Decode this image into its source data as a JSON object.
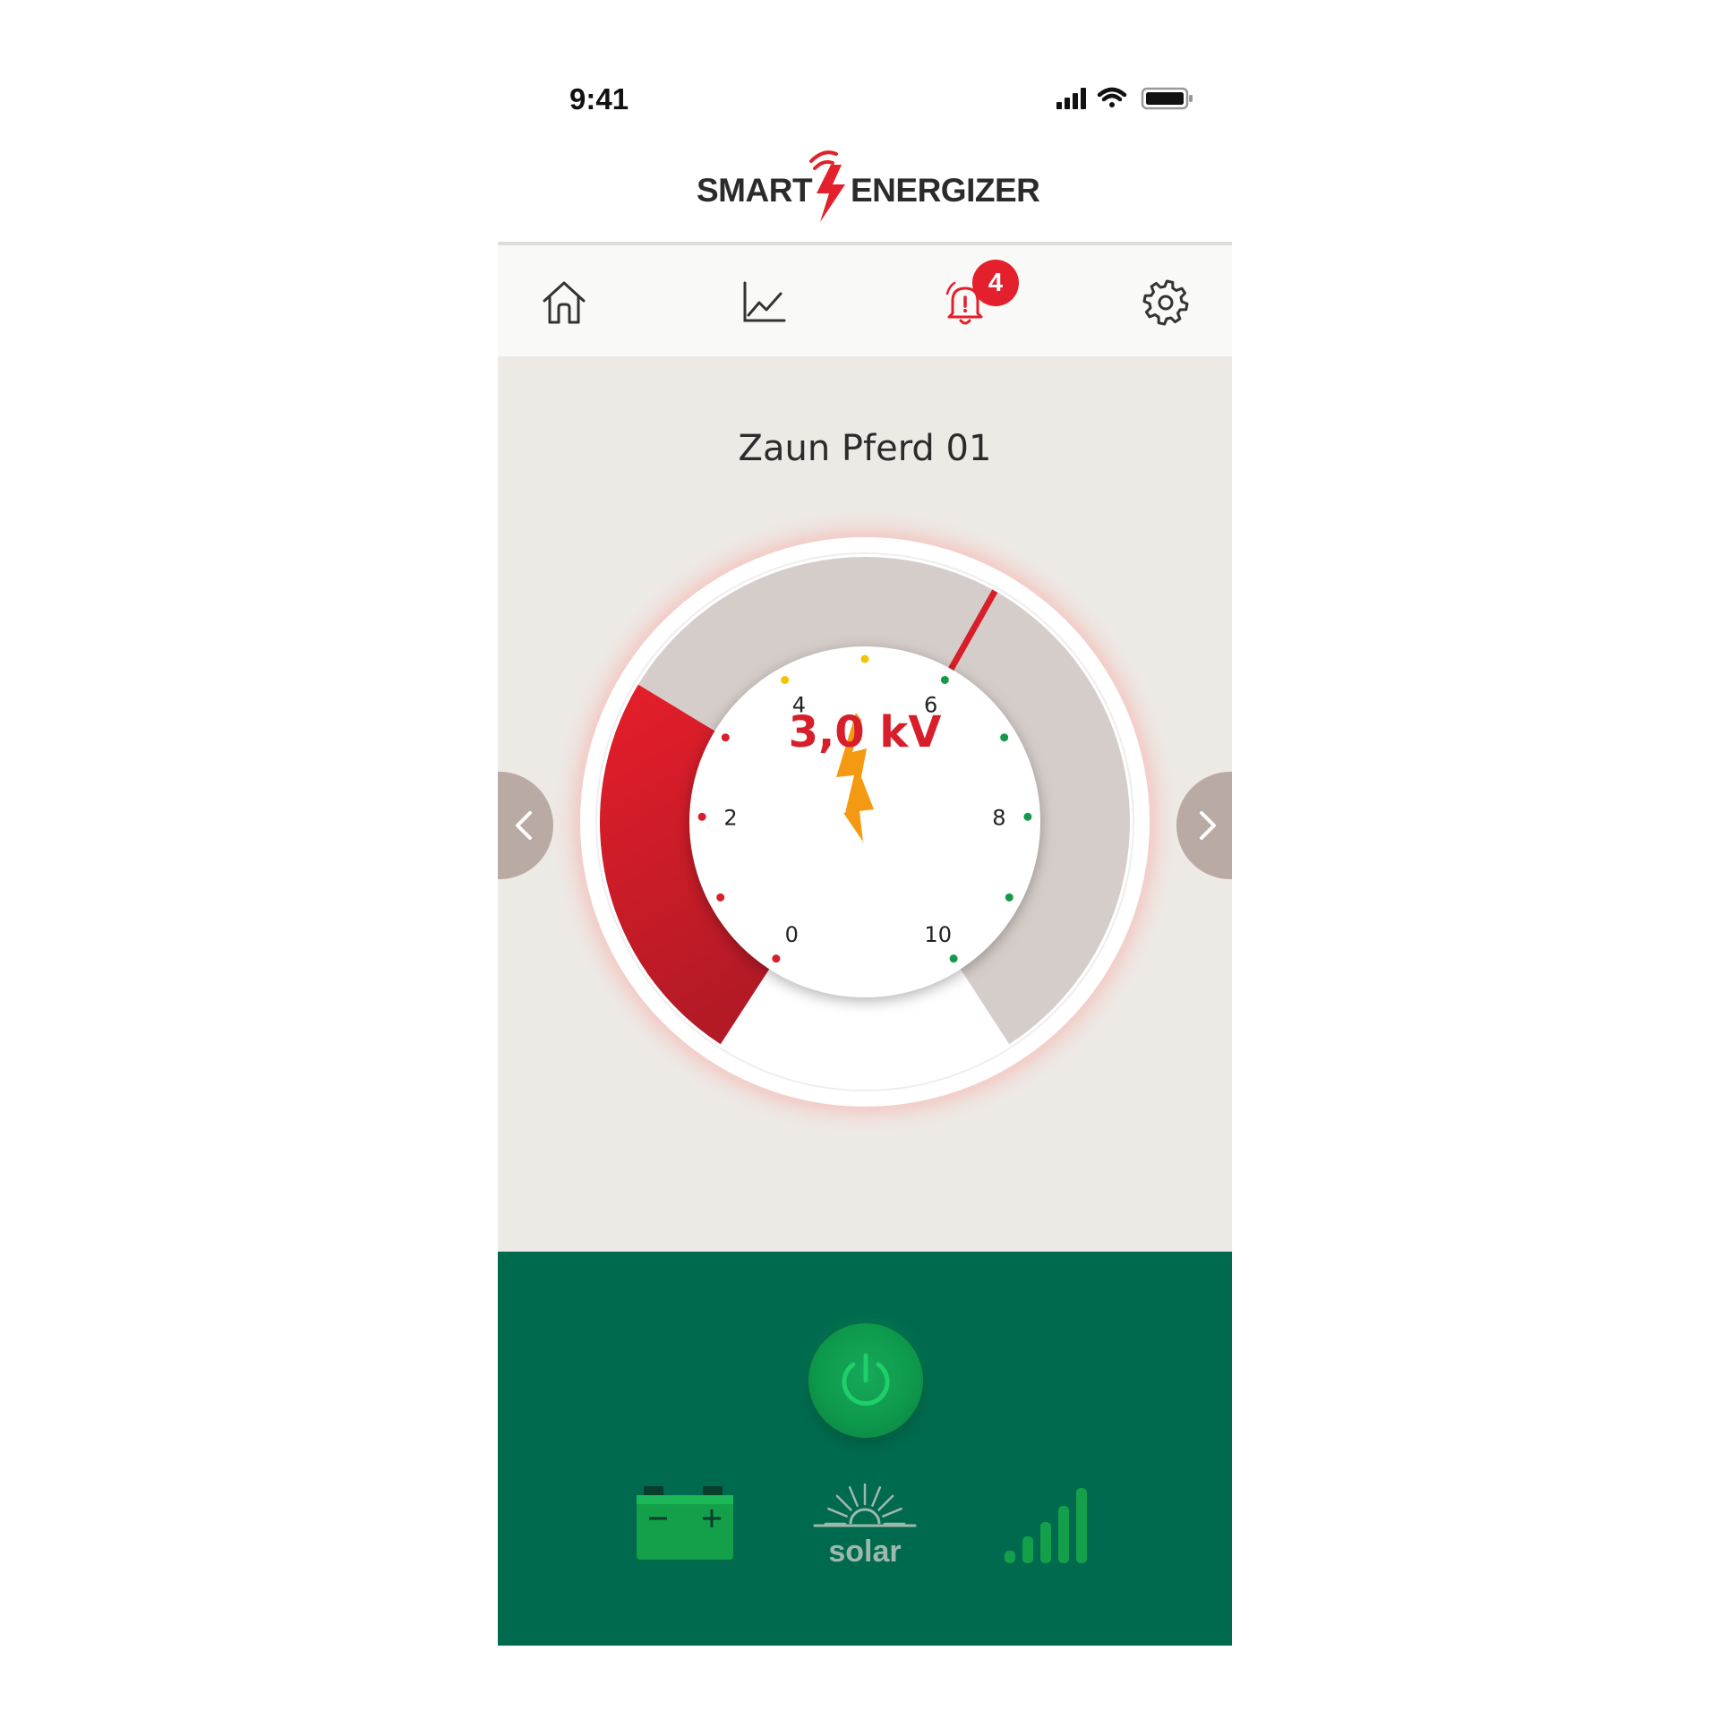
{
  "status_bar": {
    "time": "9:41",
    "icons": [
      "cellular-signal-icon",
      "wifi-icon",
      "battery-icon"
    ]
  },
  "logo": {
    "left_text": "SMART",
    "right_text": "ENERGIZER",
    "bolt_color": "#e3202c"
  },
  "nav": {
    "items": [
      {
        "icon": "home-icon"
      },
      {
        "icon": "chart-icon"
      },
      {
        "icon": "bell-alert-icon",
        "badge": "4",
        "active": true
      },
      {
        "icon": "gear-icon"
      }
    ]
  },
  "device": {
    "name": "Zaun Pferd 01"
  },
  "gauge": {
    "value_label": "3,0 kV",
    "value": 3.0,
    "min": 0,
    "max": 10,
    "tick_labels": [
      "0",
      "2",
      "4",
      "6",
      "8",
      "10"
    ],
    "marker_value": 6,
    "colors": {
      "fill": "#e3202c",
      "track": "#d5cdc9",
      "bolt": "#f39a12",
      "value_text": "#d81e2a",
      "dot_red": "#d81e2a",
      "dot_yellow": "#f2c400",
      "dot_green": "#139a48"
    }
  },
  "bottom_panel": {
    "power": {
      "icon": "power-icon"
    },
    "battery": {
      "icon": "battery-status-icon"
    },
    "solar": {
      "icon": "solar-icon",
      "label": "solar"
    },
    "signal": {
      "icon": "signal-strength-icon"
    },
    "colors": {
      "background": "#006a4e",
      "accent": "#12a04c"
    }
  }
}
